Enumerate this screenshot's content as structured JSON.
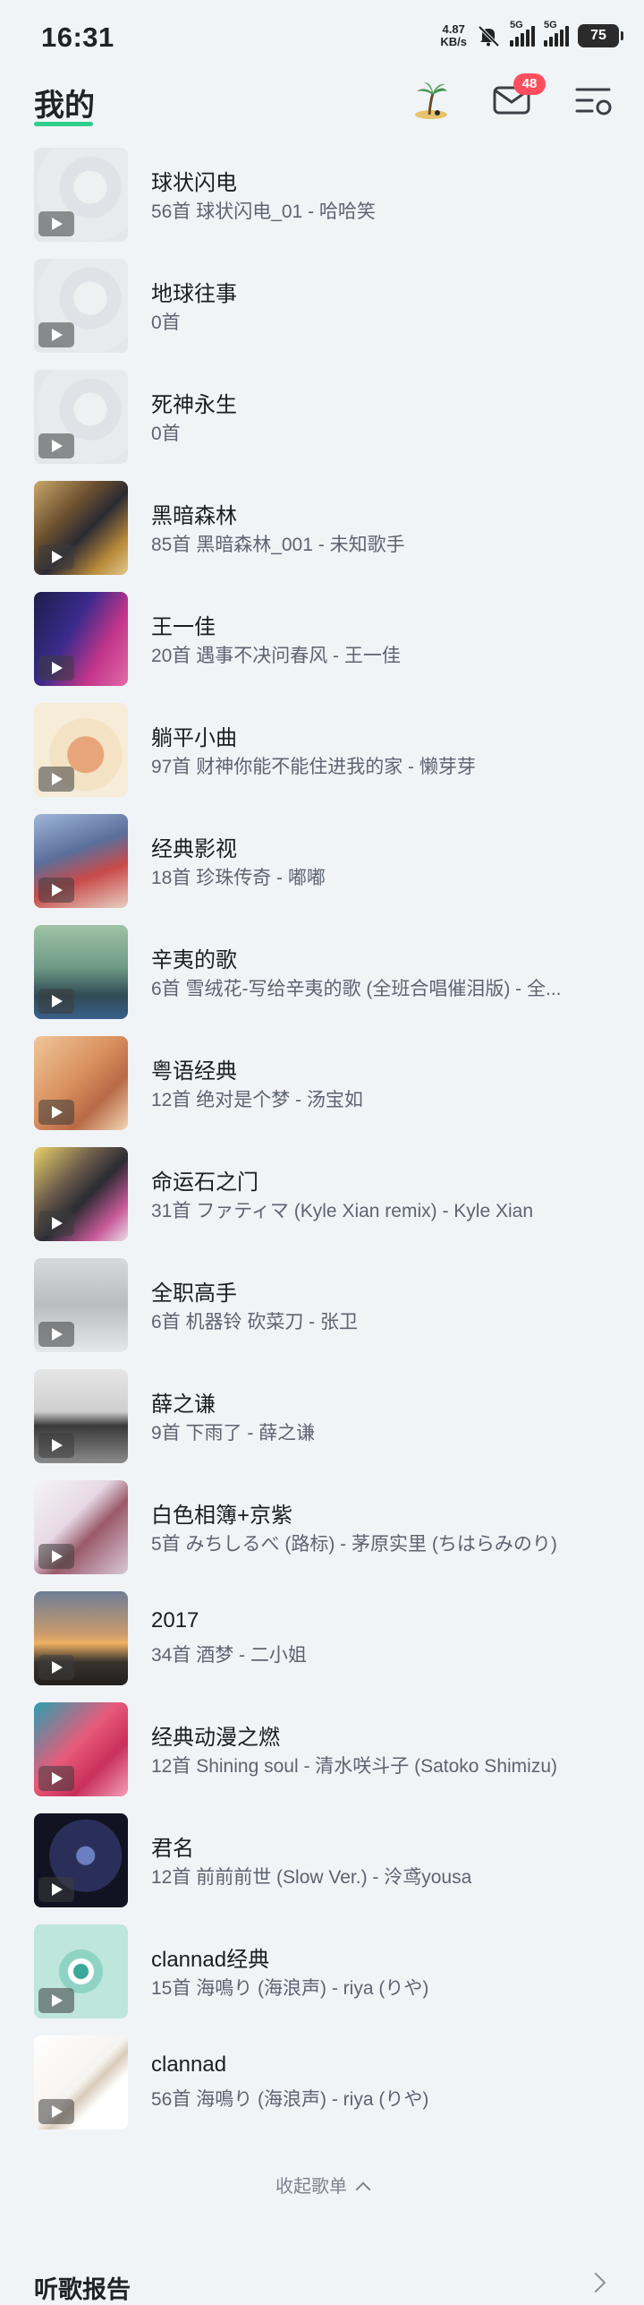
{
  "status_bar": {
    "time": "16:31",
    "net_speed_value": "4.87",
    "net_speed_unit": "KB/s",
    "signal1_label": "5G",
    "signal2_label": "5G",
    "battery": "75"
  },
  "header": {
    "title": "我的",
    "message_badge": "48"
  },
  "playlists": [
    {
      "name": "球状闪电",
      "subtitle": "56首 球状闪电_01 - 哈哈笑"
    },
    {
      "name": "地球往事",
      "subtitle": "0首"
    },
    {
      "name": "死神永生",
      "subtitle": "0首"
    },
    {
      "name": "黑暗森林",
      "subtitle": "85首 黑暗森林_001 - 未知歌手"
    },
    {
      "name": "王一佳",
      "subtitle": "20首 遇事不决问春风 - 王一佳"
    },
    {
      "name": "躺平小曲",
      "subtitle": "97首 财神你能不能住进我的家 - 懒芽芽"
    },
    {
      "name": "经典影视",
      "subtitle": "18首 珍珠传奇 - 嘟嘟"
    },
    {
      "name": "辛夷的歌",
      "subtitle": "6首 雪绒花-写给辛夷的歌 (全班合唱催泪版) - 全..."
    },
    {
      "name": "粤语经典",
      "subtitle": "12首 绝对是个梦 - 汤宝如"
    },
    {
      "name": "命运石之门",
      "subtitle": "31首 ファティマ (Kyle Xian remix) - Kyle Xian"
    },
    {
      "name": "全职高手",
      "subtitle": "6首 机器铃 砍菜刀 - 张卫"
    },
    {
      "name": "薛之谦",
      "subtitle": "9首 下雨了 - 薛之谦"
    },
    {
      "name": "白色相簿+京紫",
      "subtitle": "5首 みちしるべ (路标) - 茅原实里 (ちはらみのり)"
    },
    {
      "name": "2017",
      "subtitle": "34首 酒梦 - 二小姐"
    },
    {
      "name": "经典动漫之燃",
      "subtitle": "12首 Shining soul - 清水咲斗子 (Satoko Shimizu)"
    },
    {
      "name": "君名",
      "subtitle": "12首 前前前世 (Slow Ver.) - 泠鸢yousa"
    },
    {
      "name": "clannad经典",
      "subtitle": "15首 海鳴り (海浪声) - riya (りや)"
    },
    {
      "name": "clannad",
      "subtitle": "56首 海鳴り (海浪声) - riya (りや)"
    }
  ],
  "collapse_label": "收起歌单",
  "report_label": "听歌报告",
  "colors": {
    "accent": "#2ecf8b",
    "badge": "#ff4f5e",
    "background": "#f1f4f7"
  },
  "icons": [
    "island-tree-icon",
    "mail-icon",
    "settings-list-icon",
    "play-icon",
    "chevron-up-icon",
    "chevron-right-icon"
  ]
}
